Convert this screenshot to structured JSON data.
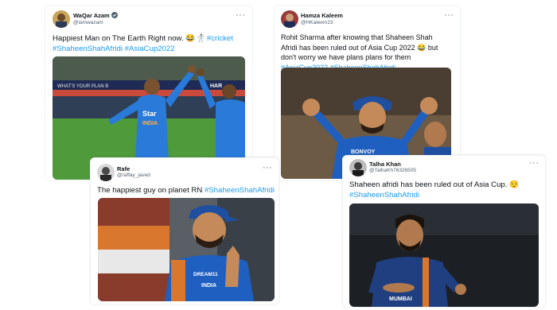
{
  "tweets": [
    {
      "name": "WaQar Azam",
      "handle": "@iamwazam",
      "verified": true,
      "text": "Happiest Man on The Earth Right now.",
      "emoji": "😂🤺",
      "hashtags": [
        "#cricket",
        "#ShaheenShahAfridi",
        "#AsiaCup2022"
      ],
      "media_board": [
        "WHAT'S YOUR PLAN B",
        "HAR"
      ],
      "media_shirt": [
        "Star",
        "INDIA"
      ]
    },
    {
      "name": "Hamza Kaleem",
      "handle": "@HKaleem23",
      "verified": false,
      "text": "Rohit Sharma after knowing that Shaheen Shah Afridi has been ruled out of Asia Cup 2022",
      "emoji_1": "😂",
      "text_2": "but don't worry we have plans plans for them",
      "hashtags": [
        "#AsiaCup2022",
        "#ShaheenShahAfridi"
      ],
      "media_shirt": [
        "BONVOY"
      ]
    },
    {
      "name": "Rafe",
      "handle": "@raffay_javed",
      "verified": false,
      "text": "The happiest guy on planet RN",
      "hashtags": [
        "#ShaheenShahAfridi"
      ],
      "media_shirt": [
        "DREAM11",
        "INDIA"
      ]
    },
    {
      "name": "Talha Khan",
      "handle": "@TalhaKh76326505",
      "verified": false,
      "text": "Shaheen afridi has been ruled out of Asia Cup.",
      "emoji": "😌",
      "hashtags": [
        "#ShaheenShahAfridi"
      ],
      "media_shirt": [
        "MUMBAI"
      ]
    }
  ],
  "more_glyph": "···"
}
